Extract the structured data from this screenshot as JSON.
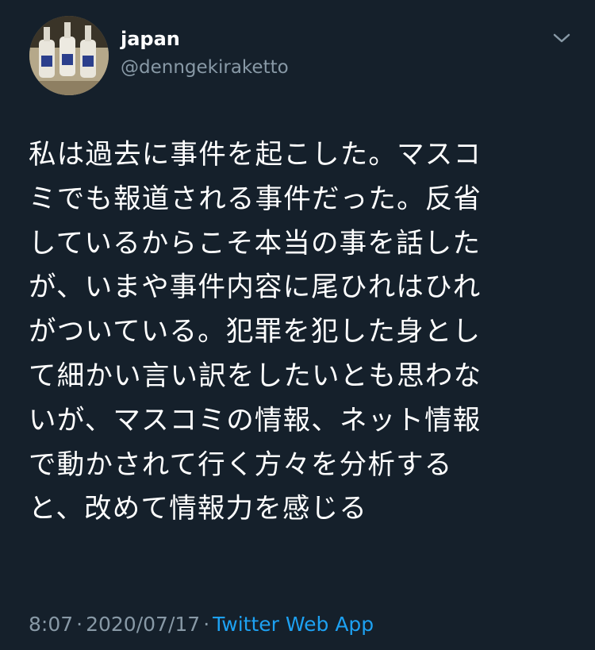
{
  "user": {
    "display_name": "japan",
    "handle": "@denngekiraketto"
  },
  "tweet": {
    "text": "私は過去に事件を起こした。マスコ\nミでも報道される事件だった。反省\nしているからこそ本当の事を話した\nが、いまや事件内容に尾ひれはひれ\nがついている。犯罪を犯した身とし\nて細かい言い訳をしたいとも思わな\nいが、マスコミの情報、ネット情報\nで動かされて行く方々を分析する\nと、改めて情報力を感じる",
    "time": "8:07",
    "separator": "·",
    "date": "2020/07/17",
    "source": "Twitter Web App"
  },
  "icons": {
    "caret": "chevron-down-icon",
    "avatar": "sake-bottles-photo"
  },
  "colors": {
    "background": "#15202b",
    "text_primary": "#ffffff",
    "text_secondary": "#8899a6",
    "link": "#1da1f2"
  }
}
